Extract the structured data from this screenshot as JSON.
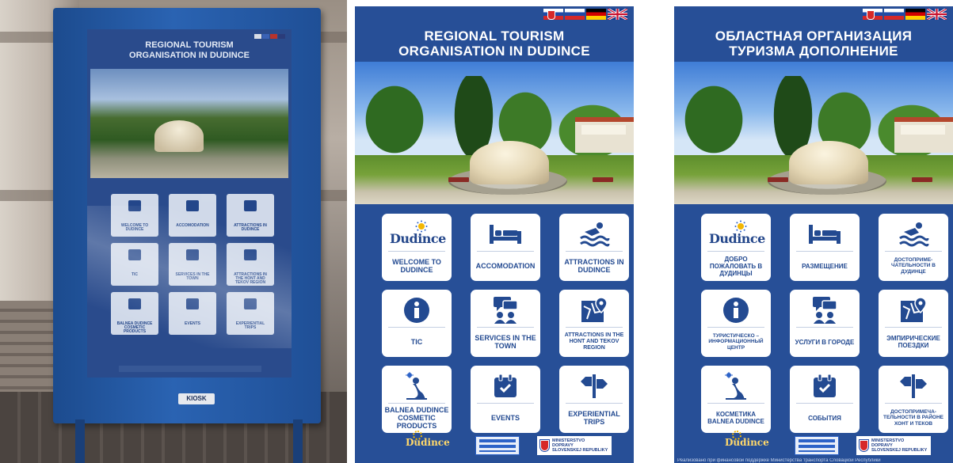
{
  "colors": {
    "panel_blue": "#274f97",
    "tile_white": "#ffffff",
    "label_blue": "#234a91",
    "kiosk_blue": "#2a63b2"
  },
  "languages": [
    "sk",
    "ru",
    "de",
    "gb"
  ],
  "photo": {
    "kiosk_brand": "KIOSK"
  },
  "english": {
    "title_line1": "REGIONAL TOURISM",
    "title_line2": "ORGANISATION IN DUDINCE",
    "logo_word": "Dudince",
    "tiles": [
      {
        "label": "WELCOME TO DUDINCE",
        "icon": "dudince-logo-icon"
      },
      {
        "label": "ACCOMODATION",
        "icon": "bed-icon"
      },
      {
        "label": "ATTRACTIONS IN DUDINCE",
        "icon": "swimmer-icon"
      },
      {
        "label": "TIC",
        "icon": "info-icon"
      },
      {
        "label": "SERVICES IN THE TOWN",
        "icon": "chat-people-icon"
      },
      {
        "label": "ATTRACTIONS IN THE HONT AND TEKOV REGION",
        "icon": "map-pin-icon"
      },
      {
        "label": "BALNEA DUDINCE COSMETIC PRODUCTS",
        "icon": "mermaid-icon"
      },
      {
        "label": "EVENTS",
        "icon": "calendar-icon"
      },
      {
        "label": "EXPERIENTIAL TRIPS",
        "icon": "signpost-icon"
      }
    ],
    "footer_logo": "Dudince",
    "ministry_line1": "MINISTERSTVO",
    "ministry_line2": "DOPRAVY",
    "ministry_line3": "SLOVENSKEJ REPUBLIKY"
  },
  "russian": {
    "title_line1": "ОБЛАСТНАЯ ОРГАНИЗАЦИЯ",
    "title_line2": "ТУРИЗМА ДОПОЛНЕНИЕ",
    "logo_word": "Dudince",
    "tiles": [
      {
        "label": "ДОБРО ПОЖАЛОВАТЬ В ДУДИНЦЫ",
        "icon": "dudince-logo-icon"
      },
      {
        "label": "РАЗМЕЩЕНИЕ",
        "icon": "bed-icon"
      },
      {
        "label": "ДОСТОПРИМЕ- ЧАТЕЛЬНОСТИ В ДУДИНЦЕ",
        "icon": "swimmer-icon"
      },
      {
        "label": "ТУРИСТИЧЕСКО – ИНФОРМАЦИОННЫЙ ЦЕНТР",
        "icon": "info-icon"
      },
      {
        "label": "УСЛУГИ В ГОРОДЕ",
        "icon": "chat-people-icon"
      },
      {
        "label": "ЭМПИРИЧЕСКИЕ ПОЕЗДКИ",
        "icon": "map-pin-icon"
      },
      {
        "label": "КОСМЕТИКА BALNEA DUDINCE",
        "icon": "mermaid-icon"
      },
      {
        "label": "СОБЫТИЯ",
        "icon": "calendar-icon"
      },
      {
        "label": "ДОСТОПРИМЕЧА- ТЕЛЬНОСТИ В РАЙОНЕ ХОНТ И ТЕКОВ",
        "icon": "signpost-icon"
      }
    ],
    "footer_logo": "Dudince",
    "ministry_line1": "MINISTERSTVO",
    "ministry_line2": "DOPRAVY",
    "ministry_line3": "SLOVENSKEJ REPUBLIKY",
    "fineprint": "Реализовано при финансовой поддержке Министерства транспорта Словацкой Республики"
  }
}
